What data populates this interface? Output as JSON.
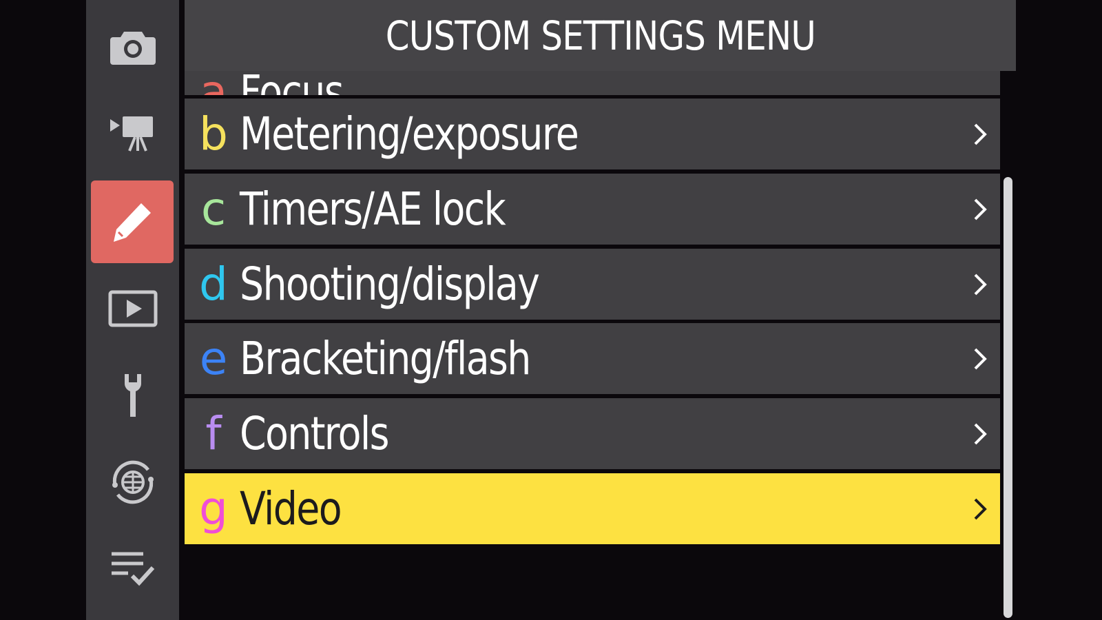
{
  "title": "CUSTOM SETTINGS MENU",
  "tabs": [
    {
      "icon": "camera-icon",
      "name": "photo-shooting"
    },
    {
      "icon": "video-camera-icon",
      "name": "video-recording"
    },
    {
      "icon": "pencil-icon",
      "name": "custom-settings",
      "active": true
    },
    {
      "icon": "playback-icon",
      "name": "playback"
    },
    {
      "icon": "wrench-icon",
      "name": "setup"
    },
    {
      "icon": "network-icon",
      "name": "network"
    },
    {
      "icon": "checklist-icon",
      "name": "my-menu"
    }
  ],
  "menu": {
    "partial_item": {
      "letter": "a",
      "label": "Focus",
      "letter_color": "#e9675f"
    },
    "items": [
      {
        "letter": "b",
        "label": "Metering/exposure",
        "letter_color": "#f5e15d"
      },
      {
        "letter": "c",
        "label": "Timers/AE lock",
        "letter_color": "#a7e69b"
      },
      {
        "letter": "d",
        "label": "Shooting/display",
        "letter_color": "#2fc7ef"
      },
      {
        "letter": "e",
        "label": "Bracketing/flash",
        "letter_color": "#3c83f6"
      },
      {
        "letter": "f",
        "label": "Controls",
        "letter_color": "#b98df1"
      },
      {
        "letter": "g",
        "label": "Video",
        "letter_color": "#f04ed6",
        "selected": true
      }
    ]
  },
  "colors": {
    "selected_background": "#fde141",
    "row_background": "#414043",
    "active_tab": "#e06862"
  }
}
